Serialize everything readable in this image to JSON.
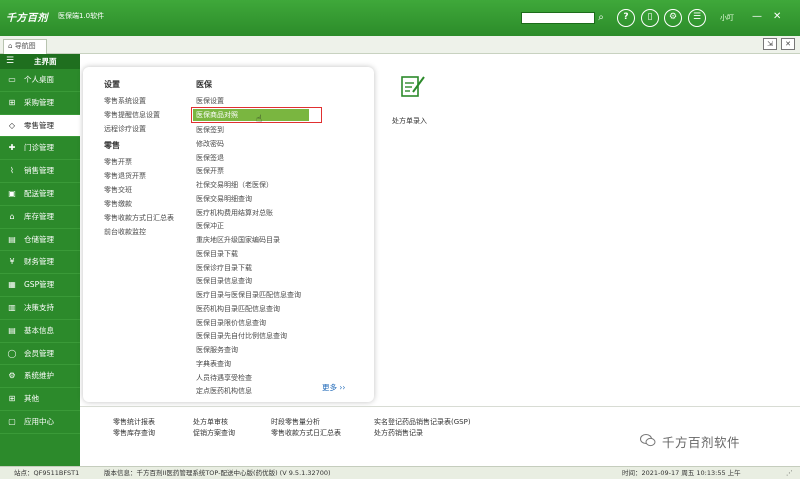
{
  "titlebar": {
    "logo": "千方百剂",
    "subtitle": "医保端1.0软件",
    "search_placeholder": "",
    "username": "小叮",
    "buttons": [
      "?",
      "▯",
      "⚙",
      "☰"
    ],
    "search_icon": "search-icon"
  },
  "tabs": {
    "nav_tab": "导航图"
  },
  "sidebar": {
    "header": "主界面",
    "items": [
      {
        "label": "个人桌面",
        "icon": "monitor-icon"
      },
      {
        "label": "采购管理",
        "icon": "cart-icon"
      },
      {
        "label": "零售管理",
        "icon": "tag-icon",
        "active": true
      },
      {
        "label": "门诊管理",
        "icon": "cross-icon"
      },
      {
        "label": "销售管理",
        "icon": "chart-icon"
      },
      {
        "label": "配送管理",
        "icon": "truck-icon"
      },
      {
        "label": "库存管理",
        "icon": "warehouse-icon"
      },
      {
        "label": "仓储管理",
        "icon": "truck-icon"
      },
      {
        "label": "财务管理",
        "icon": "yen-icon"
      },
      {
        "label": "GSP管理",
        "icon": "gsp-icon"
      },
      {
        "label": "决策支持",
        "icon": "decision-icon"
      },
      {
        "label": "基本信息",
        "icon": "info-icon"
      },
      {
        "label": "会员管理",
        "icon": "member-icon"
      },
      {
        "label": "系统维护",
        "icon": "gear-icon"
      },
      {
        "label": "其他",
        "icon": "grid-icon"
      },
      {
        "label": "应用中心",
        "icon": "app-icon"
      }
    ]
  },
  "menu": {
    "col1": {
      "title1": "设置",
      "items1": [
        "零售系统设置",
        "零售提醒信息设置",
        "远程诊疗设置"
      ],
      "title2": "零售",
      "items2": [
        "零售开票",
        "零售退货开票",
        "零售交班",
        "零售缴款",
        "零售收款方式日汇总表",
        "前台收款监控"
      ]
    },
    "col2": {
      "title": "医保",
      "items": [
        "医保设置",
        "医保商品对照",
        "医保签到",
        "修改密码",
        "医保签退",
        "医保开票",
        "社保交易明细（老医保）",
        "医保交易明细查询",
        "医疗机构费用结算对总账",
        "医保冲正",
        "重庆地区升级国家编码目录",
        "医保目录下载",
        "医保诊疗目录下载",
        "医保目录信息查询",
        "医疗目录与医保目录匹配信息查询",
        "医药机构目录匹配信息查询",
        "医保目录限价信息查询",
        "医保目录先自付比例信息查询",
        "医保服务查询",
        "字典表查询",
        "人员待遇享受检查",
        "定点医药机构信息"
      ]
    },
    "more": "更多 ››",
    "prescription_label": "处方单录入"
  },
  "bottom_links": [
    [
      "零售统计报表",
      "零售库存查询"
    ],
    [
      "处方单审核",
      "促销方案查询"
    ],
    [
      "时段零售量分析",
      "零售收款方式日汇总表"
    ],
    [
      "实名登记药品销售记录表(GSP)",
      "处方药销售记录"
    ]
  ],
  "watermark": "千方百剂软件",
  "status": {
    "site": "站点：QF9511BFST1",
    "version": "版本信息：千方百剂II医药管理系统TOP-配送中心版(药优版) (V 9.5.1.32700)",
    "time": "时间：2021-09-17  周五  10:13:55  上午"
  },
  "colors": {
    "brand": "#2c8a2b",
    "highlight": "#7ab640",
    "highlight_border": "#e03030"
  }
}
